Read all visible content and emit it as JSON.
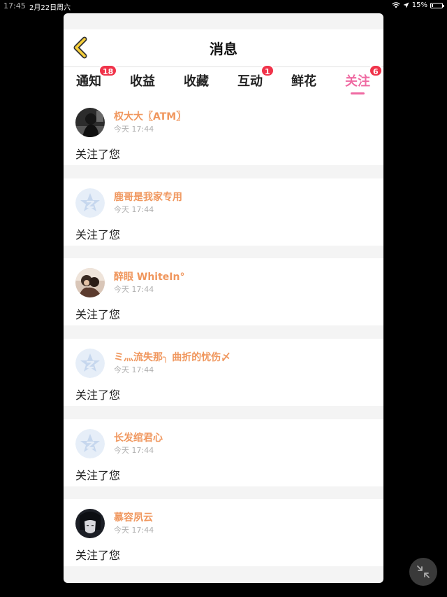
{
  "status_bar": {
    "time": "17:45",
    "date": "2月22日周六",
    "battery_percent": "15%",
    "battery_level": 0.15
  },
  "header": {
    "title": "消息"
  },
  "tabs": [
    {
      "label": "通知",
      "badge": "18"
    },
    {
      "label": "收益",
      "badge": ""
    },
    {
      "label": "收藏",
      "badge": ""
    },
    {
      "label": "互动",
      "badge": "1"
    },
    {
      "label": "鲜花",
      "badge": ""
    },
    {
      "label": "关注",
      "badge": "6",
      "active": true
    }
  ],
  "colors": {
    "accent": "#ef6aa2",
    "name": "#f0975e",
    "badge": "#f0334a"
  },
  "notifications": [
    {
      "name": "权大大〖ATM〗",
      "time": "今天 17:44",
      "action": "关注了您",
      "avatar": "photo-dark"
    },
    {
      "name": "鹿哥是我家专用",
      "time": "今天 17:44",
      "action": "关注了您",
      "avatar": "default-qzone-icon"
    },
    {
      "name": "醉眼 WhiteIn°",
      "time": "今天 17:44",
      "action": "关注了您",
      "avatar": "photo-couple"
    },
    {
      "name": "ミ灬流失那╮ 曲折的忧伤〆",
      "time": "今天 17:44",
      "action": "关注了您",
      "avatar": "default-qzone-icon"
    },
    {
      "name": "长发绾君心",
      "time": "今天 17:44",
      "action": "关注了您",
      "avatar": "default-qzone-icon"
    },
    {
      "name": "慕容夙云",
      "time": "今天 17:44",
      "action": "关注了您",
      "avatar": "photo-anime"
    }
  ]
}
